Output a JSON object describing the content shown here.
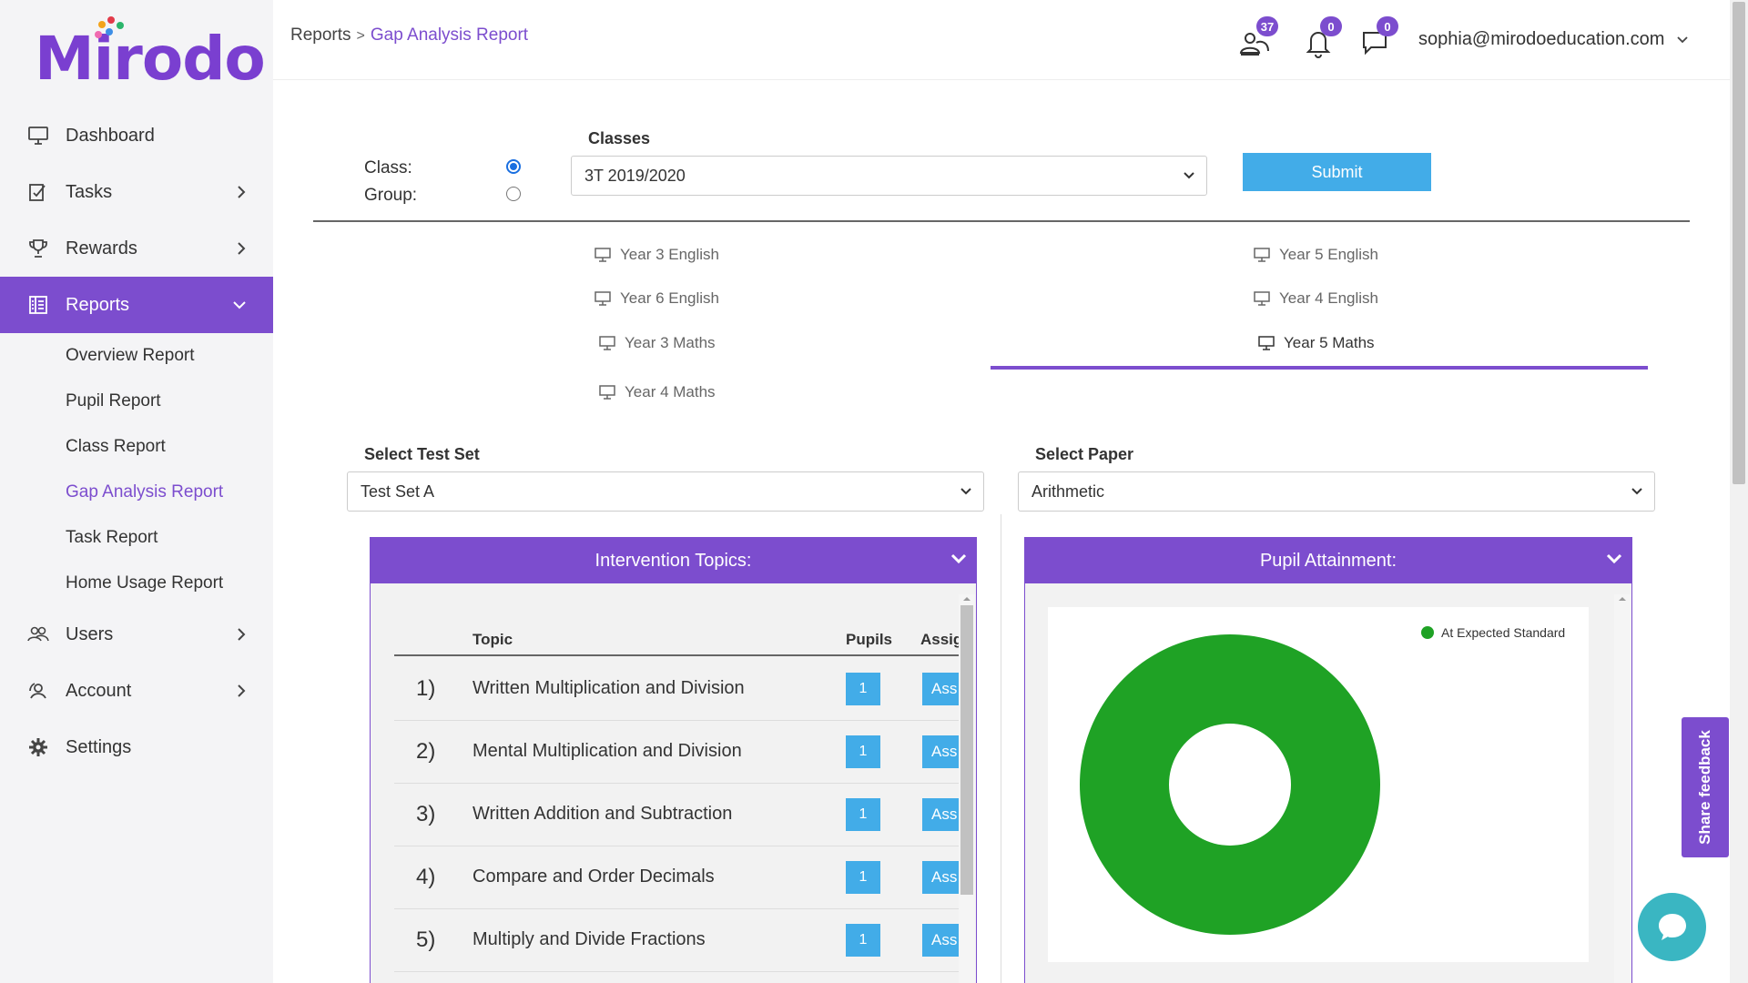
{
  "brand": {
    "name": "Mirodo"
  },
  "sidebar": {
    "items": [
      {
        "label": "Dashboard",
        "icon": "monitor-icon"
      },
      {
        "label": "Tasks",
        "icon": "tasks-icon"
      },
      {
        "label": "Rewards",
        "icon": "trophy-icon"
      },
      {
        "label": "Reports",
        "icon": "reports-icon"
      },
      {
        "label": "Users",
        "icon": "users-icon"
      },
      {
        "label": "Account",
        "icon": "account-icon"
      },
      {
        "label": "Settings",
        "icon": "gear-icon"
      }
    ],
    "reports_sub": [
      "Overview Report",
      "Pupil Report",
      "Class Report",
      "Gap Analysis Report",
      "Task Report",
      "Home Usage Report"
    ]
  },
  "header": {
    "breadcrumb_root": "Reports",
    "breadcrumb_sep": ">",
    "breadcrumb_current": "Gap Analysis Report",
    "users_badge": "37",
    "notifications_badge": "0",
    "messages_badge": "0",
    "user_email": "sophia@mirodoeducation.com"
  },
  "filters": {
    "class_label": "Class:",
    "group_label": "Group:",
    "classes_label": "Classes",
    "classes_value": "3T 2019/2020",
    "submit_label": "Submit"
  },
  "class_tabs": [
    "Year 3 English",
    "Year 5 English",
    "Year 6 English",
    "Year 4 English",
    "Year 3 Maths",
    "Year 5 Maths",
    "Year 4 Maths"
  ],
  "active_tab": "Year 5 Maths",
  "test_set": {
    "label": "Select Test Set",
    "value": "Test Set A"
  },
  "paper": {
    "label": "Select Paper",
    "value": "Arithmetic"
  },
  "intervention": {
    "title": "Intervention Topics:",
    "columns": {
      "topic": "Topic",
      "pupils": "Pupils",
      "assign": "Assig"
    },
    "assign_label": "Ass",
    "rows": [
      {
        "num": "1)",
        "topic": "Written Multiplication and Division",
        "pupils": "1"
      },
      {
        "num": "2)",
        "topic": "Mental Multiplication and Division",
        "pupils": "1"
      },
      {
        "num": "3)",
        "topic": "Written Addition and Subtraction",
        "pupils": "1"
      },
      {
        "num": "4)",
        "topic": "Compare and Order Decimals",
        "pupils": "1"
      },
      {
        "num": "5)",
        "topic": "Multiply and Divide Fractions",
        "pupils": "1"
      }
    ]
  },
  "attainment": {
    "title": "Pupil Attainment:"
  },
  "chart_data": {
    "type": "pie",
    "title": "",
    "categories": [
      "At Expected Standard"
    ],
    "values": [
      100
    ],
    "colors": [
      "#1fa225"
    ],
    "donut": true,
    "legend": "top-right"
  },
  "feedback_label": "Share feedback",
  "colors": {
    "accent": "#7c4dce",
    "button": "#42ace8",
    "chart_green": "#1fa225"
  }
}
